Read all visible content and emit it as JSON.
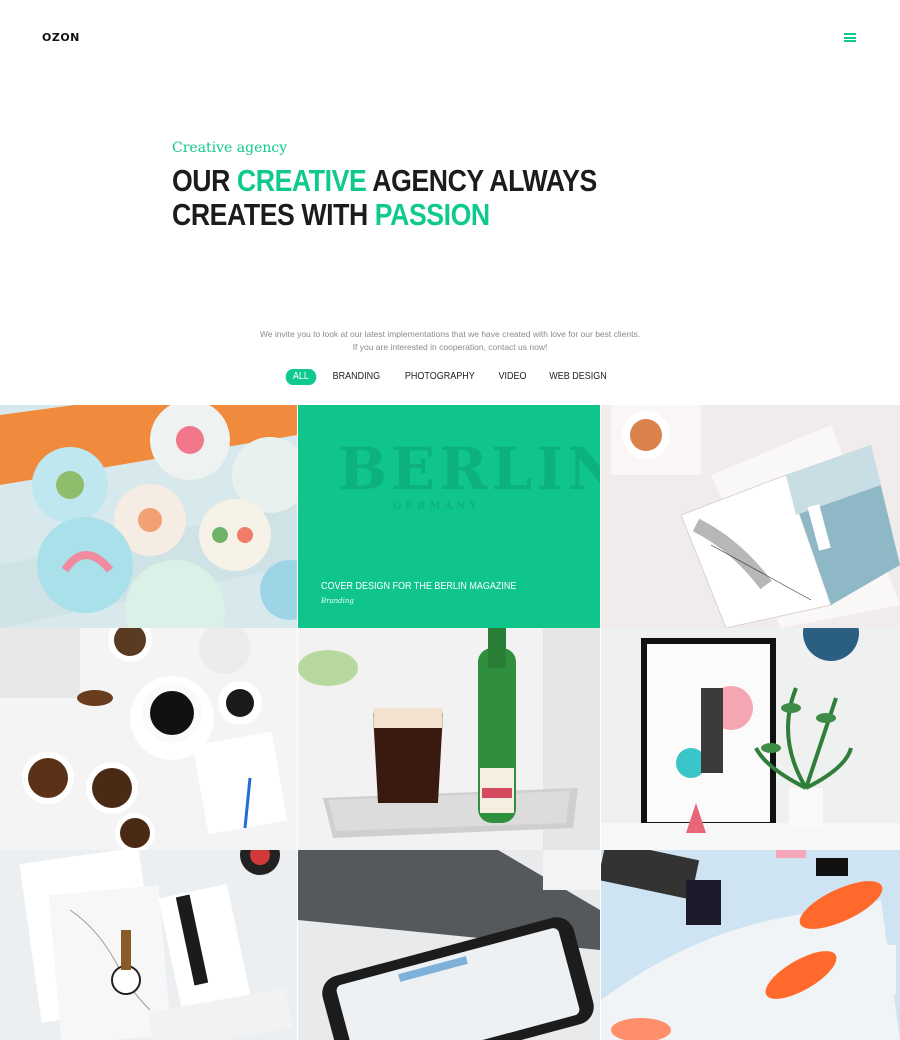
{
  "header": {
    "logo": "OZON",
    "menu_icon": "hamburger-menu-icon"
  },
  "hero": {
    "eyebrow": "Creative agency",
    "line1": {
      "a": "OUR ",
      "b": "CREATIVE",
      "c": " AGENCY ALWAYS"
    },
    "line2": {
      "a": "CREATES WITH ",
      "b": "PASSION"
    }
  },
  "intro": {
    "line1": "We invite you to look at our latest implementations that we have created with love for our best clients.",
    "line2": "If you are interested in cooperation, contact us now!"
  },
  "filters": [
    "ALL",
    "BRANDING",
    "PHOTOGRAPHY",
    "VIDEO",
    "WEB DESIGN"
  ],
  "active_filter": "ALL",
  "portfolio": {
    "hover_item": {
      "title": "COVER DESIGN FOR THE BERLIN MAGAZINE",
      "category": "Branding"
    },
    "ghost_text": {
      "berlin": "BERLIN",
      "germany": "GERMANY"
    }
  },
  "colors": {
    "accent": "#10c98f",
    "text": "#1c1c1c",
    "muted": "#8a8a8a"
  }
}
